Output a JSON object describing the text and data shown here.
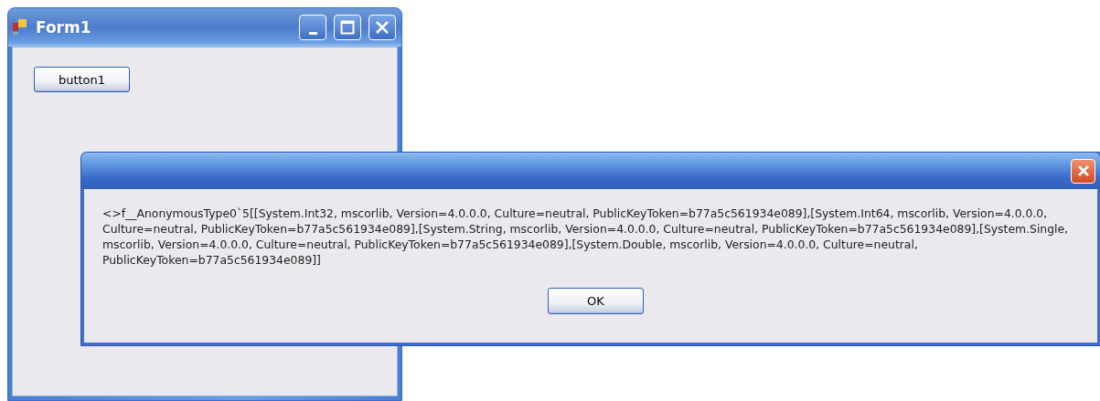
{
  "form_window": {
    "title": "Form1",
    "buttons": [
      "button1"
    ]
  },
  "message_dialog": {
    "message": "<>f__AnonymousType0`5[[System.Int32, mscorlib, Version=4.0.0.0, Culture=neutral, PublicKeyToken=b77a5c561934e089],[System.Int64, mscorlib, Version=4.0.0.0, Culture=neutral, PublicKeyToken=b77a5c561934e089],[System.String, mscorlib, Version=4.0.0.0, Culture=neutral, PublicKeyToken=b77a5c561934e089],[System.Single, mscorlib, Version=4.0.0.0, Culture=neutral, PublicKeyToken=b77a5c561934e089],[System.Double, mscorlib, Version=4.0.0.0, Culture=neutral, PublicKeyToken=b77a5c561934e089]]",
    "ok_button": "OK"
  }
}
